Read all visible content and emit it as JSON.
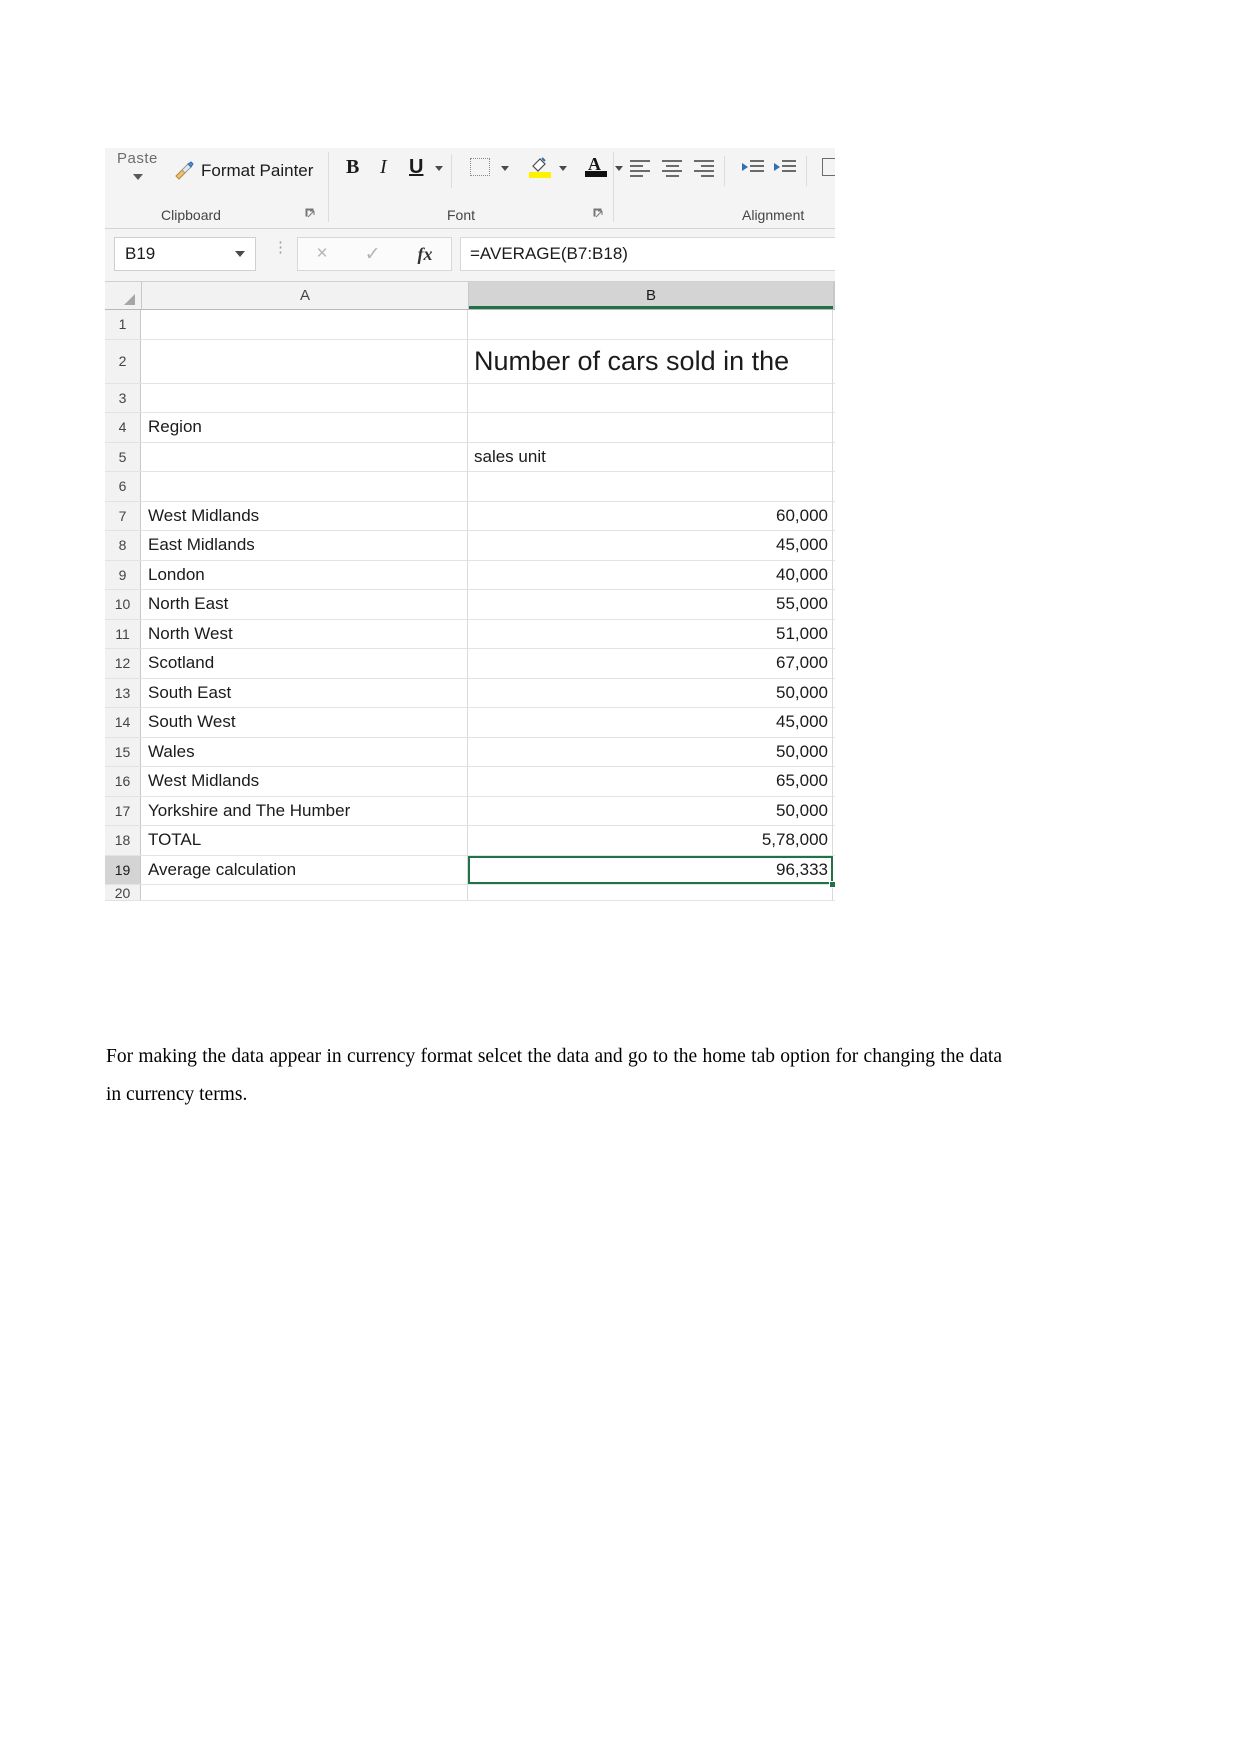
{
  "ribbon": {
    "paste_label": "Paste",
    "format_painter_label": "Format Painter",
    "clipboard_group_label": "Clipboard",
    "font_group_label": "Font",
    "alignment_group_label": "Alignment",
    "dialog_launcher_glyph": "⤵",
    "bold_label": "B",
    "italic_label": "I",
    "underline_label": "U",
    "font_color_letter": "A",
    "icons": {
      "brush": "format-painter-brush-icon",
      "borders": "borders-icon",
      "highlight": "fill-color-icon",
      "font_color": "font-color-icon",
      "align_left": "align-left-icon",
      "align_center": "align-center-icon",
      "align_right": "align-right-icon",
      "decrease_indent": "decrease-indent-icon",
      "increase_indent": "increase-indent-icon",
      "wrap_text": "wrap-text-icon"
    },
    "colors": {
      "highlight_swatch": "#fff200",
      "font_color_swatch": "#111111",
      "excel_green": "#217346"
    }
  },
  "formula_bar": {
    "name_box_value": "B19",
    "cancel_glyph": "×",
    "enter_glyph": "✓",
    "fx_label": "fx",
    "formula_value": "=AVERAGE(B7:B18)",
    "dots_glyph": "⋮"
  },
  "grid": {
    "column_headers": [
      "A",
      "B"
    ],
    "selected_column": "B",
    "selected_cell": "B19",
    "title_cell": "Number of cars sold in the",
    "rows": [
      {
        "num": "1",
        "a": "",
        "b": ""
      },
      {
        "num": "2",
        "a": "",
        "b": "Number of cars sold in the"
      },
      {
        "num": "3",
        "a": "",
        "b": ""
      },
      {
        "num": "4",
        "a": "Region",
        "b": ""
      },
      {
        "num": "5",
        "a": "",
        "b": "sales unit"
      },
      {
        "num": "6",
        "a": "",
        "b": ""
      },
      {
        "num": "7",
        "a": "West Midlands",
        "b": "60,000"
      },
      {
        "num": "8",
        "a": "East Midlands",
        "b": "45,000"
      },
      {
        "num": "9",
        "a": "London",
        "b": "40,000"
      },
      {
        "num": "10",
        "a": "North East",
        "b": "55,000"
      },
      {
        "num": "11",
        "a": "North West",
        "b": "51,000"
      },
      {
        "num": "12",
        "a": "Scotland",
        "b": "67,000"
      },
      {
        "num": "13",
        "a": "South East",
        "b": "50,000"
      },
      {
        "num": "14",
        "a": "South West",
        "b": "45,000"
      },
      {
        "num": "15",
        "a": "Wales",
        "b": "50,000"
      },
      {
        "num": "16",
        "a": "West Midlands",
        "b": "65,000"
      },
      {
        "num": "17",
        "a": "Yorkshire and The Humber",
        "b": "50,000"
      },
      {
        "num": "18",
        "a": "TOTAL",
        "b": "5,78,000"
      },
      {
        "num": "19",
        "a": "Average calculation",
        "b": "96,333"
      },
      {
        "num": "20",
        "a": "",
        "b": ""
      }
    ]
  },
  "document": {
    "paragraph": "For making the data appear in currency format selcet the data and go to the home tab option for changing the data in currency terms."
  },
  "chart_data": {
    "type": "table",
    "title": "Number of cars sold in the",
    "columns": [
      "Region",
      "sales unit"
    ],
    "categories": [
      "West Midlands",
      "East Midlands",
      "London",
      "North East",
      "North West",
      "Scotland",
      "South East",
      "South West",
      "Wales",
      "West Midlands",
      "Yorkshire and The Humber"
    ],
    "values": [
      60000,
      45000,
      40000,
      55000,
      51000,
      67000,
      50000,
      45000,
      50000,
      65000,
      50000
    ],
    "value_labels": [
      "60,000",
      "45,000",
      "40,000",
      "55,000",
      "51,000",
      "67,000",
      "50,000",
      "45,000",
      "50,000",
      "65,000",
      "50,000"
    ],
    "total_label": "TOTAL",
    "total_value": "5,78,000",
    "average_label": "Average calculation",
    "average_value": "96,333",
    "average_formula": "=AVERAGE(B7:B18)",
    "xlabel": "Region",
    "ylabel": "sales unit"
  }
}
